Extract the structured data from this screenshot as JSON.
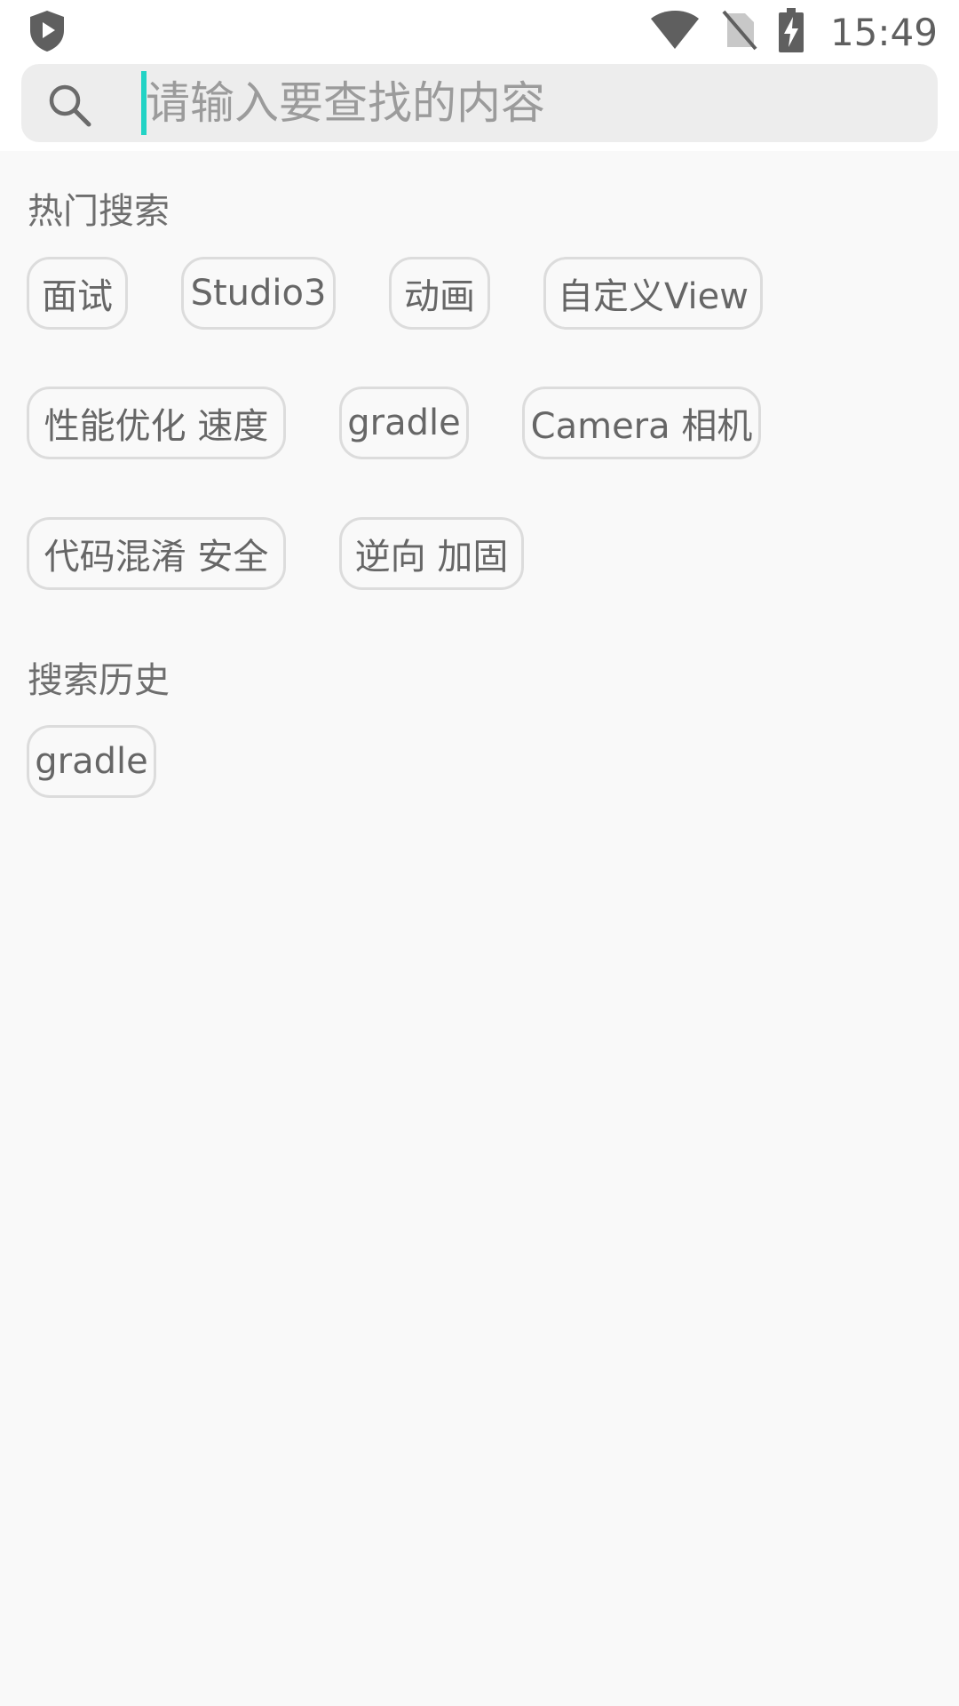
{
  "status_bar": {
    "time": "15:49",
    "icons": [
      "shield-play-icon",
      "wifi-icon",
      "no-sim-icon",
      "battery-charging-icon"
    ]
  },
  "search": {
    "placeholder": "请输入要查找的内容",
    "value": "",
    "icon": "search-icon",
    "caret_color": "#22d3c5"
  },
  "hot_search": {
    "title": "热门搜索",
    "tags": [
      "面试",
      "Studio3",
      "动画",
      "自定义View",
      "性能优化 速度",
      "gradle",
      "Camera 相机",
      "代码混淆 安全",
      "逆向 加固"
    ]
  },
  "history": {
    "title": "搜索历史",
    "tags": [
      "gradle"
    ]
  }
}
